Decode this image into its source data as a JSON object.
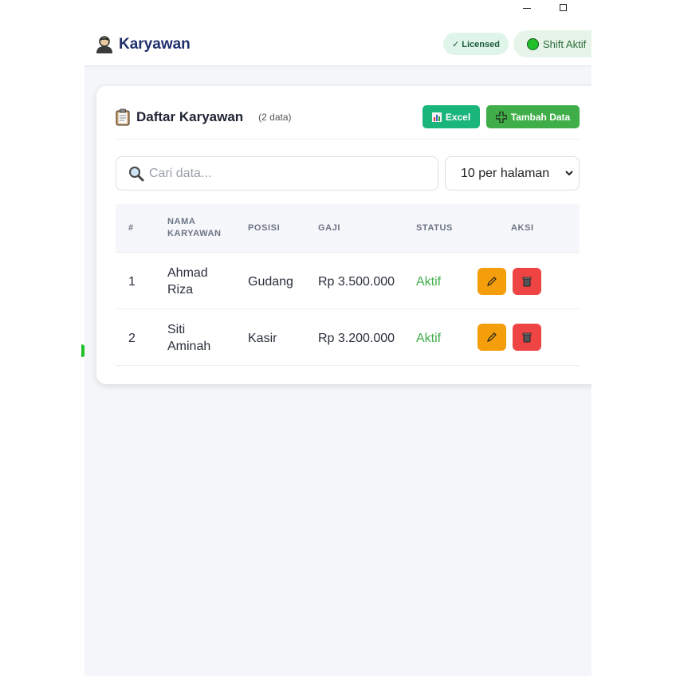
{
  "header": {
    "title": "Karyawan",
    "badge_licensed": "✓ Licensed",
    "badge_shift": "Shift Aktif"
  },
  "card": {
    "title": "Daftar Karyawan",
    "count": "(2 data)",
    "excel_label": "Excel",
    "add_label": "Tambah Data",
    "search_placeholder": "Cari data...",
    "per_page": "10 per halaman"
  },
  "table": {
    "headers": [
      "#",
      "NAMA KARYAWAN",
      "POSISI",
      "GAJI",
      "STATUS",
      "AKSI"
    ],
    "header_nama_line1": "NAMA",
    "header_nama_line2": "KARYAWAN",
    "rows": [
      {
        "no": "1",
        "name_line1": "Ahmad",
        "name_line2": "Riza",
        "position": "Gudang",
        "salary": "Rp 3.500.000",
        "status": "Aktif"
      },
      {
        "no": "2",
        "name_line1": "Siti",
        "name_line2": "Aminah",
        "position": "Kasir",
        "salary": "Rp 3.200.000",
        "status": "Aktif"
      }
    ]
  },
  "colors": {
    "brand": "#1f2f6b",
    "excel": "#19b57b",
    "add": "#3fae48",
    "edit": "#f59e0b",
    "delete": "#ef4444",
    "status_active": "#3fae48"
  },
  "icons": [
    "user-icon",
    "clipboard-icon",
    "chart-icon",
    "plus-icon",
    "search-icon",
    "chevron-down-icon",
    "pencil-icon",
    "trash-icon",
    "minimize-icon",
    "maximize-icon"
  ]
}
